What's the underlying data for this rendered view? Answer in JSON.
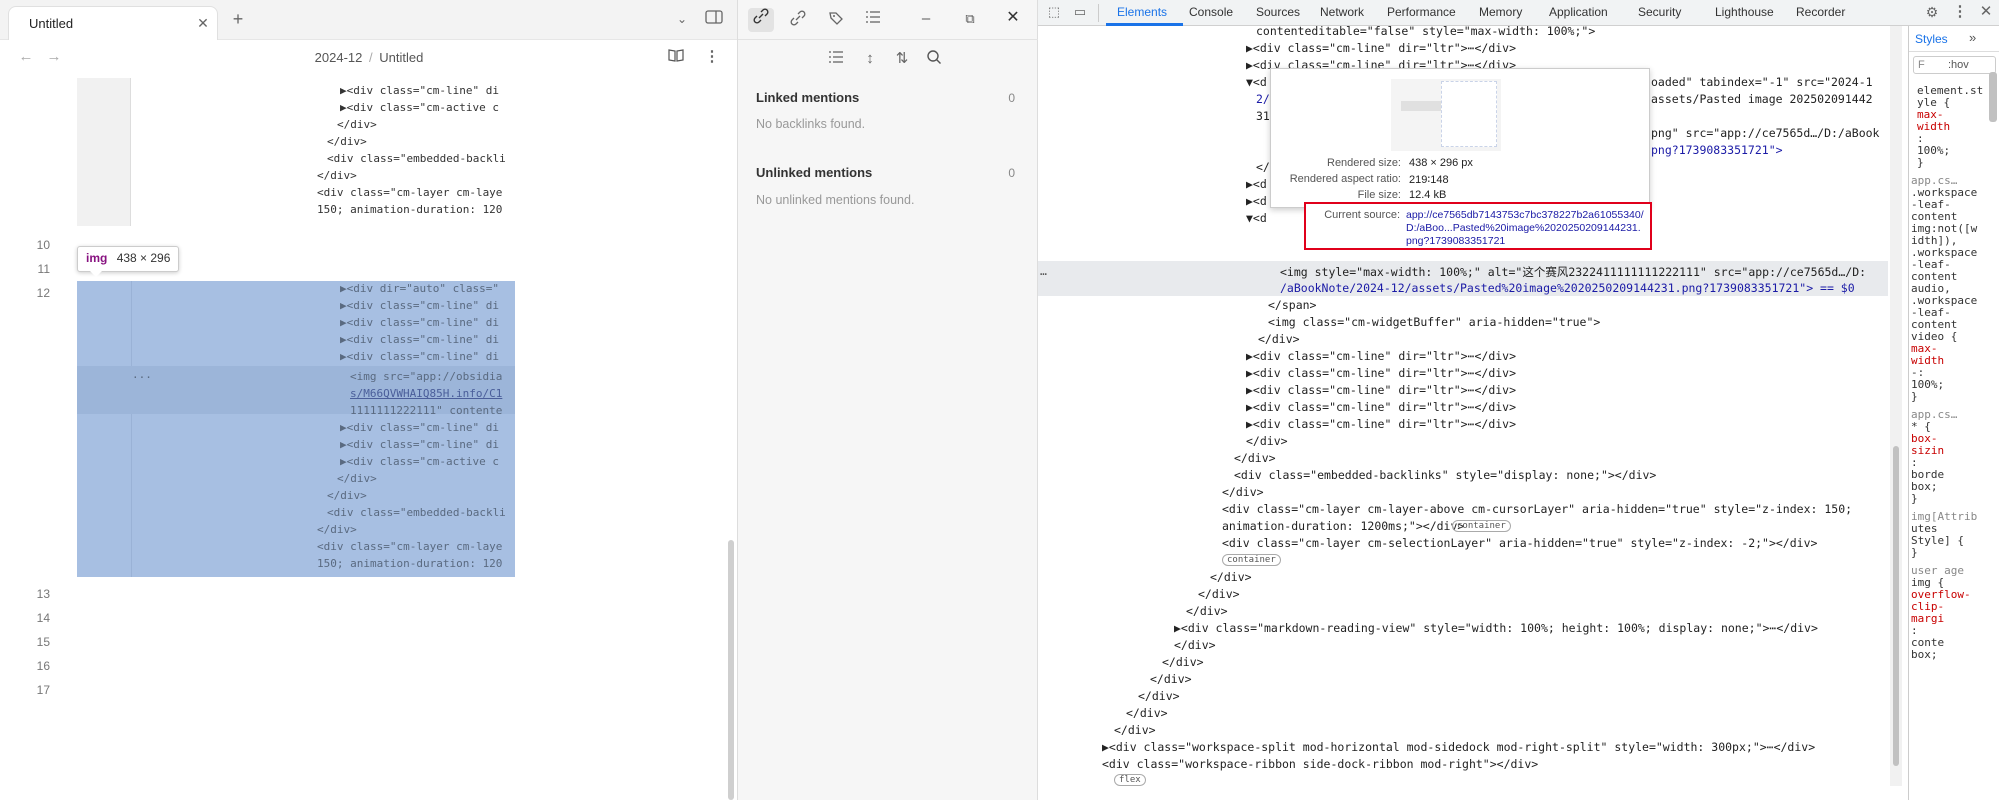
{
  "editor": {
    "tab_title": "Untitled",
    "breadcrumb_folder": "2024-12",
    "breadcrumb_sep": "/",
    "breadcrumb_file": "Untitled",
    "line_numbers": [
      "10",
      "11",
      "12",
      "13",
      "14",
      "15",
      "16",
      "17"
    ],
    "img_badge_tag": "img",
    "img_badge_size": "438 × 296",
    "ellipsis": "...",
    "upper_code": [
      "▶<div class=\"cm-line\" di",
      "▶<div class=\"cm-active c",
      "</div>",
      "</div>",
      "<div class=\"embedded-backli",
      "</div>",
      "<div class=\"cm-layer cm-laye",
      "150; animation-duration: 120"
    ],
    "image_code": [
      "▶<div dir=\"auto\" class=\"",
      "▶<div class=\"cm-line\" di",
      "▶<div class=\"cm-line\" di",
      "▶<div class=\"cm-line\" di",
      "▶<div class=\"cm-line\" di",
      "<img src=\"app://obsidia",
      "s/M66QVWHAIQ85H.info/C1",
      "1111111222111\" contente",
      "▶<div class=\"cm-line\" di",
      "▶<div class=\"cm-line\" di",
      "▶<div class=\"cm-active c",
      "</div>",
      "</div>",
      "<div class=\"embedded-backli",
      "</div>",
      "<div class=\"cm-layer cm-laye",
      "150; animation-duration: 120"
    ]
  },
  "side": {
    "linked_title": "Linked mentions",
    "linked_count": "0",
    "linked_empty": "No backlinks found.",
    "unlinked_title": "Unlinked mentions",
    "unlinked_count": "0",
    "unlinked_empty": "No unlinked mentions found."
  },
  "devtools": {
    "tabs": [
      "Elements",
      "Console",
      "Sources",
      "Network",
      "Performance",
      "Memory",
      "Application",
      "Security",
      "Lighthouse",
      "Recorder"
    ],
    "active_tab": "Elements",
    "styles_tab": "Styles",
    "filter_placeholder": "F",
    "filter_hov": ":hov",
    "tooltip": {
      "rendered_size_label": "Rendered size:",
      "rendered_size": "438 × 296 px",
      "aspect_label": "Rendered aspect ratio:",
      "aspect": "219∶148",
      "file_size_label": "File size:",
      "file_size": "12.4 kB",
      "current_source_label": "Current source:",
      "current_source": "app://ce7565db7143753c7bc378227b2a61055340/D:/aBoo...Pasted%20image%2020250209144231.png?1739083351721"
    },
    "lines": [
      "contenteditable=\"false\" style=\"max-width: 100%;\">",
      "▶<div class=\"cm-line\" dir=\"ltr\">⋯</div>",
      "▶<div class=\"cm-line\" dir=\"ltr\">⋯</div>",
      "▼<d",
      "2/",
      "31",
      "</",
      "▶<d",
      "▶<d",
      "▼<d",
      "<img style=\"max-width: 100%;\" alt=\"这个赛风2322411111111222111\" src=\"app://ce7565d…/D:",
      "/aBookNote/2024-12/assets/Pasted%20image%2020250209144231.png?1739083351721\"> == $0",
      "</span>",
      "<img class=\"cm-widgetBuffer\" aria-hidden=\"true\">",
      "</div>",
      "▶<div class=\"cm-line\" dir=\"ltr\">⋯</div>",
      "▶<div class=\"cm-line\" dir=\"ltr\">⋯</div>",
      "▶<div class=\"cm-line\" dir=\"ltr\">⋯</div>",
      "▶<div class=\"cm-line\" dir=\"ltr\">⋯</div>",
      "▶<div class=\"cm-line\" dir=\"ltr\">⋯</div>",
      "</div>",
      "</div>",
      "<div class=\"embedded-backlinks\" style=\"display: none;\"></div>",
      "</div>",
      "<div class=\"cm-layer cm-layer-above cm-cursorLayer\" aria-hidden=\"true\" style=\"z-index: 150;",
      "animation-duration: 1200ms;\"></div>",
      "<div class=\"cm-layer cm-selectionLayer\" aria-hidden=\"true\" style=\"z-index: -2;\"></div>",
      "</div>",
      "</div>",
      "</div>",
      "▶<div class=\"markdown-reading-view\" style=\"width: 100%; height: 100%; display: none;\">⋯</div>",
      "</div>",
      "</div>",
      "</div>",
      "</div>",
      "</div>",
      "</div>",
      "▶<div class=\"workspace-split mod-horizontal mod-sidedock mod-right-split\" style=\"width: 300px;\">⋯</div>",
      "<div class=\"workspace-ribbon side-dock-ribbon mod-right\"></div>"
    ],
    "right_fragments": {
      "r1": "oaded\" tabindex=\"-1\" src=\"2024-1",
      "r2": "assets/Pasted image 202502091442",
      "r3": "png\" src=\"app://ce7565d…/D:/aBook",
      "r4": "png?1739083351721\">"
    },
    "line_dots": "…",
    "badge_container": "container",
    "badge_flex": "flex",
    "styles_lines": [
      "element.st",
      "yle {",
      "max-",
      "width",
      ":",
      "100%;",
      "}",
      "app.cs…",
      ".workspace",
      "-leaf-",
      "content",
      "img:not([w",
      "idth]),",
      ".workspace",
      "-leaf-",
      "content",
      "audio,",
      ".workspace",
      "-leaf-",
      "content",
      "video {",
      "max-",
      "width",
      "-:",
      "100%;",
      "}",
      "app.cs…",
      "* {",
      "box-",
      "sizin",
      ":",
      "borde",
      "box;",
      "}",
      "img[Attrib",
      "utes",
      "Style] {",
      "}",
      "user age",
      "img {",
      "overflow-",
      "clip-",
      "margi",
      ":",
      "conte",
      "box;"
    ]
  },
  "colors": {
    "selection": "#a7bfe2",
    "accent": "#1a73e8",
    "red_box": "#e0001b"
  }
}
